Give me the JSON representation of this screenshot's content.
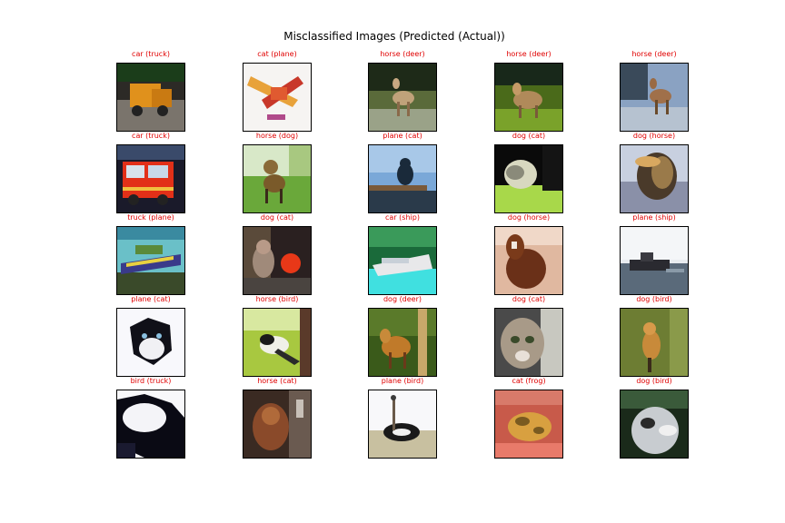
{
  "title": "Misclassified Images (Predicted (Actual))",
  "colors": {
    "caption": "#e00000",
    "title": "#000000",
    "frame": "#000000"
  },
  "chart_data": {
    "type": "image-grid",
    "title": "Misclassified Images (Predicted (Actual))",
    "rows": 5,
    "cols": 5,
    "items": [
      {
        "label": "car (truck)",
        "predicted": "car",
        "actual": "truck",
        "icon": "truck-image"
      },
      {
        "label": "cat (plane)",
        "predicted": "cat",
        "actual": "plane",
        "icon": "plane-image"
      },
      {
        "label": "horse (deer)",
        "predicted": "horse",
        "actual": "deer",
        "icon": "deer-image"
      },
      {
        "label": "horse (deer)",
        "predicted": "horse",
        "actual": "deer",
        "icon": "deer-image"
      },
      {
        "label": "horse (deer)",
        "predicted": "horse",
        "actual": "deer",
        "icon": "deer-image"
      },
      {
        "label": "car (truck)",
        "predicted": "car",
        "actual": "truck",
        "icon": "firetruck-image"
      },
      {
        "label": "horse (dog)",
        "predicted": "horse",
        "actual": "dog",
        "icon": "dog-image"
      },
      {
        "label": "plane (cat)",
        "predicted": "plane",
        "actual": "cat",
        "icon": "cat-image"
      },
      {
        "label": "dog (cat)",
        "predicted": "dog",
        "actual": "cat",
        "icon": "cat-image"
      },
      {
        "label": "dog (horse)",
        "predicted": "dog",
        "actual": "horse",
        "icon": "horse-image"
      },
      {
        "label": "truck (plane)",
        "predicted": "truck",
        "actual": "plane",
        "icon": "plane-image"
      },
      {
        "label": "dog (cat)",
        "predicted": "dog",
        "actual": "cat",
        "icon": "cat-image"
      },
      {
        "label": "car (ship)",
        "predicted": "car",
        "actual": "ship",
        "icon": "ship-image"
      },
      {
        "label": "dog (horse)",
        "predicted": "dog",
        "actual": "horse",
        "icon": "horse-image"
      },
      {
        "label": "plane (ship)",
        "predicted": "plane",
        "actual": "ship",
        "icon": "ship-image"
      },
      {
        "label": "plane (cat)",
        "predicted": "plane",
        "actual": "cat",
        "icon": "cat-image"
      },
      {
        "label": "horse (bird)",
        "predicted": "horse",
        "actual": "bird",
        "icon": "bird-image"
      },
      {
        "label": "dog (deer)",
        "predicted": "dog",
        "actual": "deer",
        "icon": "deer-image"
      },
      {
        "label": "dog (cat)",
        "predicted": "dog",
        "actual": "cat",
        "icon": "cat-image"
      },
      {
        "label": "dog (bird)",
        "predicted": "dog",
        "actual": "bird",
        "icon": "bird-image"
      },
      {
        "label": "bird (truck)",
        "predicted": "bird",
        "actual": "truck",
        "icon": "truck-image"
      },
      {
        "label": "horse (cat)",
        "predicted": "horse",
        "actual": "cat",
        "icon": "cat-image"
      },
      {
        "label": "plane (bird)",
        "predicted": "plane",
        "actual": "bird",
        "icon": "ostrich-image"
      },
      {
        "label": "cat (frog)",
        "predicted": "cat",
        "actual": "frog",
        "icon": "frog-image"
      },
      {
        "label": "dog (bird)",
        "predicted": "dog",
        "actual": "bird",
        "icon": "bird-image"
      }
    ]
  }
}
